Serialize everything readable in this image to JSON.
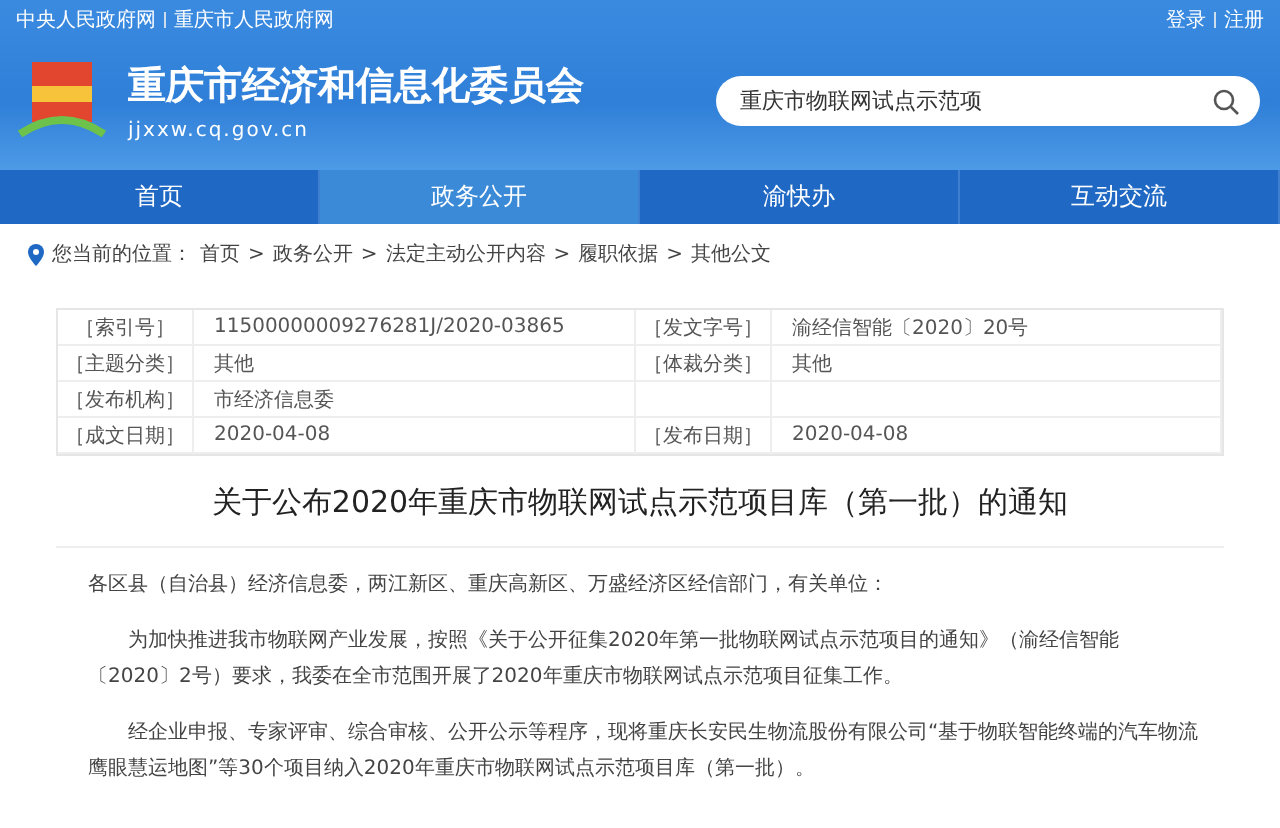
{
  "top_links": {
    "left": [
      "中央人民政府网",
      "重庆市人民政府网"
    ],
    "right": [
      "登录",
      "注册"
    ]
  },
  "site": {
    "name": "重庆市经济和信息化委员会",
    "domain": "jjxxw.cq.gov.cn"
  },
  "search": {
    "value": "重庆市物联网试点示范项"
  },
  "nav": [
    {
      "label": "首页",
      "selected": false
    },
    {
      "label": "政务公开",
      "selected": true
    },
    {
      "label": "渝快办",
      "selected": false
    },
    {
      "label": "互动交流",
      "selected": false
    }
  ],
  "breadcrumb": {
    "prefix": "您当前的位置：",
    "separator": ">",
    "items": [
      "首页",
      "政务公开",
      "法定主动公开内容",
      "履职依据",
      "其他公文"
    ]
  },
  "meta_rows": [
    [
      {
        "label": "［索引号］",
        "value": "11500000009276281J/2020-03865"
      },
      {
        "label": "［发文字号］",
        "value": "渝经信智能〔2020〕20号"
      }
    ],
    [
      {
        "label": "［主题分类］",
        "value": "其他"
      },
      {
        "label": "［体裁分类］",
        "value": "其他"
      }
    ],
    [
      {
        "label": "［发布机构］",
        "value": "市经济信息委"
      }
    ],
    [
      {
        "label": "［成文日期］",
        "value": "2020-04-08"
      },
      {
        "label": "［发布日期］",
        "value": "2020-04-08"
      }
    ]
  ],
  "article": {
    "title": "关于公布2020年重庆市物联网试点示范项目库（第一批）的通知",
    "paragraphs": [
      {
        "kind": "salutation",
        "text": "各区县（自治县）经济信息委，两江新区、重庆高新区、万盛经济区经信部门，有关单位："
      },
      {
        "kind": "body",
        "text": "为加快推进我市物联网产业发展，按照《关于公开征集2020年第一批物联网试点示范项目的通知》（渝经信智能〔2020〕2号）要求，我委在全市范围开展了2020年重庆市物联网试点示范项目征集工作。"
      },
      {
        "kind": "body",
        "text": "经企业申报、专家评审、综合审核、公开公示等程序，现将重庆长安民生物流股份有限公司“基于物联智能终端的汽车物流鹰眼慧运地图”等30个项目纳入2020年重庆市物联网试点示范项目库（第一批）。"
      }
    ]
  }
}
